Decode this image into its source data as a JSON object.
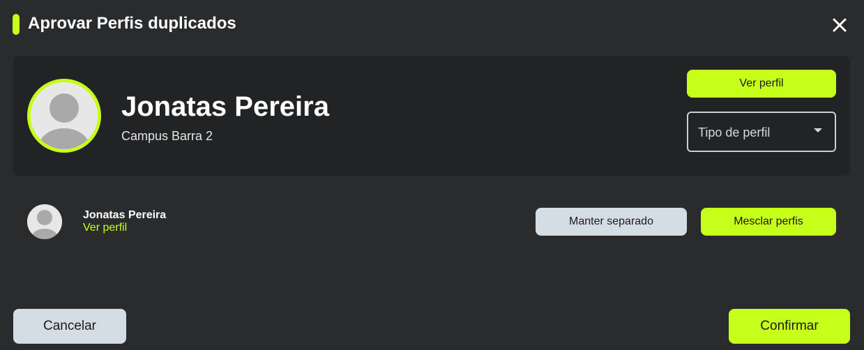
{
  "dialog": {
    "title": "Aprovar Perfis duplicados",
    "close_icon": "close-icon"
  },
  "main_profile": {
    "name": "Jonatas Pereira",
    "campus": "Campus Barra 2",
    "ver_perfil_label": "Ver perfil",
    "profile_type": {
      "placeholder": "Tipo de perfil"
    },
    "avatar_icon": "user-avatar-icon"
  },
  "duplicate": {
    "name": "Jonatas Pereira",
    "link_label": "Ver perfil",
    "manter_label": "Manter separado",
    "mesclar_label": "Mesclar perfis",
    "avatar_icon": "user-avatar-icon"
  },
  "footer": {
    "cancel_label": "Cancelar",
    "confirm_label": "Confirmar"
  },
  "colors": {
    "accent": "#c6ff1a",
    "background": "#2a2b2d",
    "card": "#222324",
    "secondary_button": "#d5dde4"
  }
}
